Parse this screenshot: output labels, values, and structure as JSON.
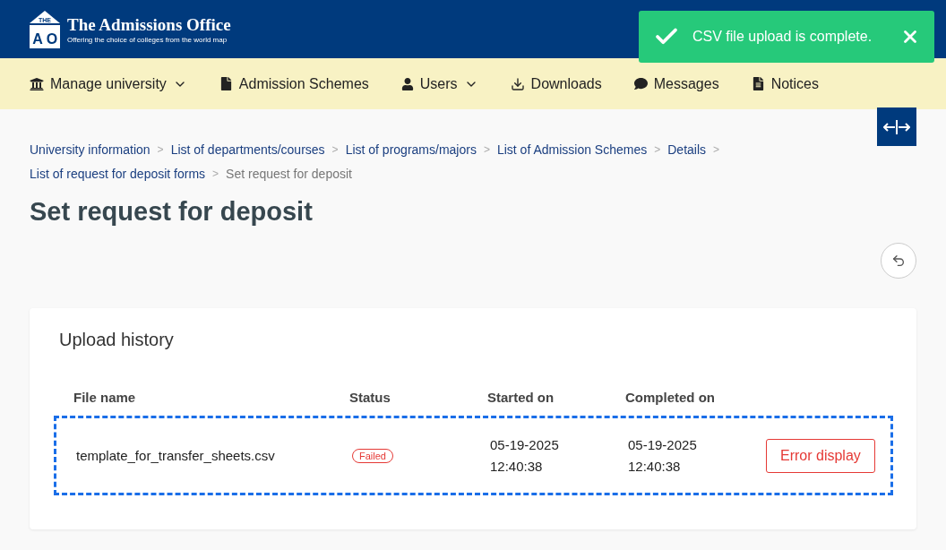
{
  "header": {
    "logo_mark": {
      "top": "THE",
      "left": "A",
      "right": "O"
    },
    "title": "The Admissions Office",
    "tagline": "Offering the choice of colleges from the world map"
  },
  "toast": {
    "message": "CSV file upload is complete."
  },
  "nav": [
    {
      "kind": "university",
      "label": "Manage university",
      "dropdown": true
    },
    {
      "kind": "file",
      "label": "Admission Schemes",
      "dropdown": false
    },
    {
      "kind": "user",
      "label": "Users",
      "dropdown": true
    },
    {
      "kind": "download",
      "label": "Downloads",
      "dropdown": false
    },
    {
      "kind": "chat",
      "label": "Messages",
      "dropdown": false
    },
    {
      "kind": "notice",
      "label": "Notices",
      "dropdown": false
    }
  ],
  "breadcrumbs": [
    {
      "label": "University information",
      "current": false
    },
    {
      "separator": ">",
      "label": "List of departments/courses",
      "current": false
    },
    {
      "separator": ">",
      "label": "List of programs/majors",
      "current": false
    },
    {
      "separator": ">",
      "label": "List of Admission Schemes",
      "current": false
    },
    {
      "separator": ">",
      "label": "Details",
      "current": false
    },
    {
      "separator": ">",
      "label": "List of request for deposit forms",
      "current": false
    },
    {
      "separator": ">",
      "label": "Set request for deposit",
      "current": true
    }
  ],
  "page_title": "Set request for deposit",
  "card": {
    "title": "Upload history",
    "table": {
      "columns": [
        "File name",
        "Status",
        "Started on",
        "Completed on"
      ],
      "rows": [
        {
          "file_name": "template_for_transfer_sheets.csv",
          "status": "Failed",
          "started_date": "05-19-2025",
          "started_time": "12:40:38",
          "completed_date": "05-19-2025",
          "completed_time": "12:40:38",
          "action": "Error display",
          "highlighted": true
        }
      ]
    }
  }
}
